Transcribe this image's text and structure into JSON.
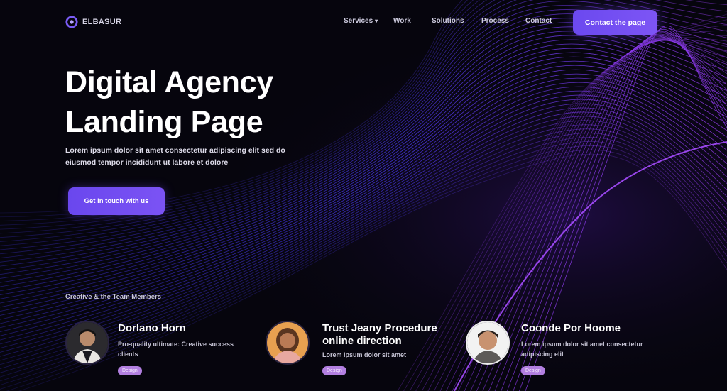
{
  "brand": {
    "name": "ELBASUR",
    "accent": "#6c4bef",
    "accent_light": "#b27fe0",
    "bg": "#06050d"
  },
  "nav": {
    "items": [
      {
        "label": "Services",
        "has_dropdown": true
      },
      {
        "label": "Work",
        "has_dropdown": false
      },
      {
        "label": "Solutions",
        "has_dropdown": false
      },
      {
        "label": "Process",
        "has_dropdown": false
      },
      {
        "label": "Contact",
        "has_dropdown": false
      }
    ],
    "cta_label": "Contact the page"
  },
  "hero": {
    "title_line1": "Digital Agency",
    "title_line2": "Landing Page",
    "description": "Lorem ipsum dolor sit amet consectetur adipiscing elit sed do eiusmod tempor incididunt ut labore et dolore",
    "cta_label": "Get in touch with us"
  },
  "team": {
    "heading": "Creative & the Team Members",
    "members": [
      {
        "name": "Dorlano Horn",
        "description": "Pro-quality ultimate: Creative success clients",
        "tag": "Design"
      },
      {
        "name": "Trust Jeany Procedure\nonline direction",
        "description": "Lorem ipsum dolor sit amet",
        "tag": "Design"
      },
      {
        "name": "Coonde Por Hoome",
        "description": "Lorem ipsum dolor sit amet consectetur adipiscing elit",
        "tag": "Design"
      }
    ]
  }
}
